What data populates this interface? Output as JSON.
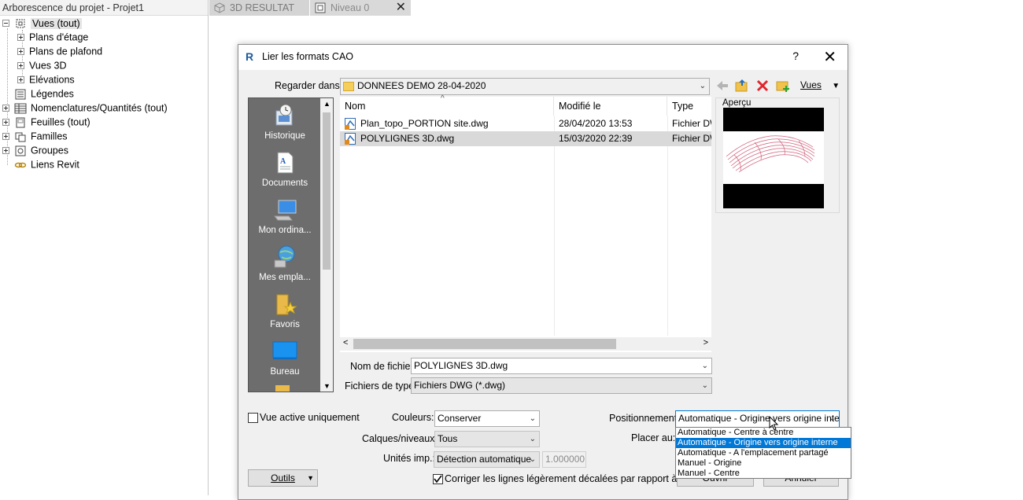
{
  "project_browser": {
    "title": "Arborescence du projet - Projet1",
    "items": [
      {
        "label": "Vues (tout)",
        "icon": "views-icon",
        "expanded": true
      },
      {
        "label": "Plans d'étage",
        "icon": "",
        "expanded": false
      },
      {
        "label": "Plans de plafond",
        "icon": "",
        "expanded": false
      },
      {
        "label": "Vues 3D",
        "icon": "",
        "expanded": false
      },
      {
        "label": "Elévations",
        "icon": "",
        "expanded": false
      },
      {
        "label": "Légendes",
        "icon": "legend-icon",
        "expanded": null
      },
      {
        "label": "Nomenclatures/Quantités (tout)",
        "icon": "schedule-icon",
        "expanded": false
      },
      {
        "label": "Feuilles (tout)",
        "icon": "sheet-icon",
        "expanded": false
      },
      {
        "label": "Familles",
        "icon": "families-icon",
        "expanded": false
      },
      {
        "label": "Groupes",
        "icon": "groups-icon",
        "expanded": false
      },
      {
        "label": "Liens Revit",
        "icon": "link-icon",
        "expanded": null
      }
    ]
  },
  "tabs": [
    {
      "label": "3D RESULTAT",
      "icon": "3d-view-icon"
    },
    {
      "label": "Niveau 0",
      "icon": "floor-plan-icon",
      "close": "✕"
    }
  ],
  "dialog": {
    "title": "Lier les formats CAO",
    "help": "?",
    "close": "✕",
    "look_in_label": "Regarder dans:",
    "look_in_value": "DONNEES DEMO 28-04-2020",
    "views_label": "Vues",
    "places": [
      {
        "label": "Historique",
        "icon": "history-icon"
      },
      {
        "label": "Documents",
        "icon": "documents-icon"
      },
      {
        "label": "Mon ordina...",
        "icon": "computer-icon"
      },
      {
        "label": "Mes empla...",
        "icon": "network-icon"
      },
      {
        "label": "Favoris",
        "icon": "favorites-icon"
      },
      {
        "label": "Bureau",
        "icon": "desktop-icon"
      }
    ],
    "columns": {
      "name": "Nom",
      "modified": "Modifié le",
      "type": "Type"
    },
    "files": [
      {
        "name": "Plan_topo_PORTION site.dwg",
        "modified": "28/04/2020 13:53",
        "type": "Fichier DWG",
        "selected": false
      },
      {
        "name": "POLYLIGNES 3D.dwg",
        "modified": "15/03/2020 22:39",
        "type": "Fichier DWG",
        "selected": true
      }
    ],
    "preview_label": "Aperçu",
    "filename_label": "Nom de fichier:",
    "filename_value": "POLYLIGNES 3D.dwg",
    "filetype_label": "Fichiers de type:",
    "filetype_value": "Fichiers DWG  (*.dwg)",
    "active_view_only_label": "Vue active uniquement",
    "active_view_only_checked": false,
    "colors_label": "Couleurs:",
    "colors_value": "Conserver",
    "layers_label": "Calques/niveaux:",
    "layers_value": "Tous",
    "units_label": "Unités imp.:",
    "units_value": "Détection automatique",
    "units_factor": "1.000000",
    "correct_lines_label": "Corriger les lignes légèrement décalées par rapport à l'axe",
    "correct_lines_checked": true,
    "positioning_label": "Positionnement:",
    "positioning_value": "Automatique - Origine vers origine inte",
    "place_at_label": "Placer au:",
    "tools_label": "Outils",
    "open_label": "Ouvrir",
    "cancel_label": "Annuler",
    "positioning_options": [
      "Automatique - Centre à centre",
      "Automatique - Origine vers origine interne",
      "Automatique - A l'emplacement partagé",
      "Manuel - Origine",
      "Manuel - Centre"
    ],
    "positioning_highlighted_index": 1
  }
}
